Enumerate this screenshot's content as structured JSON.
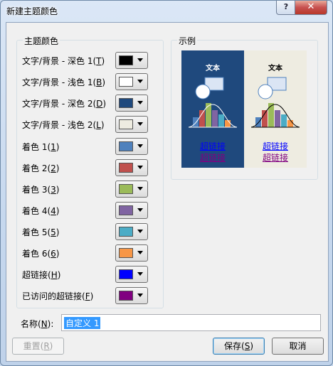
{
  "window": {
    "title": "新建主题颜色",
    "help_glyph": "?",
    "close_glyph": "✕"
  },
  "theme_group": {
    "label": "主题颜色",
    "rows": [
      {
        "label": "文字/背景 - 深色 1(",
        "key": "T",
        "suffix": ")",
        "color": "#000000"
      },
      {
        "label": "文字/背景 - 浅色 1(",
        "key": "B",
        "suffix": ")",
        "color": "#ffffff"
      },
      {
        "label": "文字/背景 - 深色 2(",
        "key": "D",
        "suffix": ")",
        "color": "#1f497d"
      },
      {
        "label": "文字/背景 - 浅色 2(",
        "key": "L",
        "suffix": ")",
        "color": "#eeece1"
      },
      {
        "label": "着色 1(",
        "key": "1",
        "suffix": ")",
        "color": "#4f81bd"
      },
      {
        "label": "着色 2(",
        "key": "2",
        "suffix": ")",
        "color": "#c0504d"
      },
      {
        "label": "着色 3(",
        "key": "3",
        "suffix": ")",
        "color": "#9bbb59"
      },
      {
        "label": "着色 4(",
        "key": "4",
        "suffix": ")",
        "color": "#8064a2"
      },
      {
        "label": "着色 5(",
        "key": "5",
        "suffix": ")",
        "color": "#4bacc6"
      },
      {
        "label": "着色 6(",
        "key": "6",
        "suffix": ")",
        "color": "#f79646"
      },
      {
        "label": "超链接(",
        "key": "H",
        "suffix": ")",
        "color": "#0000ff"
      },
      {
        "label": "已访问的超链接(",
        "key": "F",
        "suffix": ")",
        "color": "#800080"
      }
    ]
  },
  "sample_group": {
    "label": "示例",
    "dark_pane": {
      "title": "文本",
      "link": "超链接",
      "visited_link": "超链接",
      "bg": "#1f497d",
      "title_color": "#ffffff",
      "link_color": "#0000ff",
      "visited_color": "#800080"
    },
    "light_pane": {
      "title": "文本",
      "link": "超链接",
      "visited_link": "超链接",
      "bg": "#eeece1",
      "title_color": "#000000",
      "link_color": "#0000ff",
      "visited_color": "#800080"
    }
  },
  "name_field": {
    "label": "名称(",
    "key": "N",
    "suffix": "):",
    "value": "自定义 1"
  },
  "buttons": {
    "reset": {
      "label": "重置(",
      "key": "R",
      "suffix": ")"
    },
    "save": {
      "label": "保存(",
      "key": "S",
      "suffix": ")"
    },
    "cancel": {
      "label": "取消"
    }
  }
}
